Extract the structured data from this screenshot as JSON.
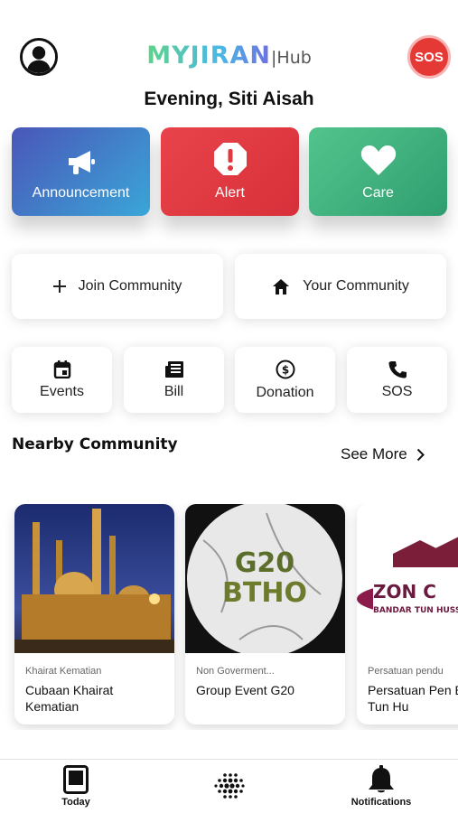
{
  "header": {
    "logo_brand": "MYJIRAN",
    "logo_sub": "|Hub",
    "sos_label": "SOS"
  },
  "greeting": "Evening, Siti Aisah",
  "big_tiles": [
    {
      "label": "Announcement",
      "icon": "megaphone-icon",
      "color": "#3f7fd0"
    },
    {
      "label": "Alert",
      "icon": "alert-octagon-icon",
      "color": "#e0393f"
    },
    {
      "label": "Care",
      "icon": "heart-icon",
      "color": "#3fb07f"
    }
  ],
  "mid_buttons": [
    {
      "label": "Join Community",
      "icon": "plus-icon"
    },
    {
      "label": "Your Community",
      "icon": "home-icon"
    }
  ],
  "small_buttons": [
    {
      "label": "Events",
      "icon": "calendar-icon"
    },
    {
      "label": "Bill",
      "icon": "receipt-icon"
    },
    {
      "label": "Donation",
      "icon": "dollar-coin-icon"
    },
    {
      "label": "SOS",
      "icon": "phone-icon"
    }
  ],
  "nearby": {
    "title": "Nearby Community",
    "see_more": "See More",
    "cards": [
      {
        "category": "Khairat Kematian",
        "name": "Cubaan Khairat Kematian"
      },
      {
        "category": "Non Goverment...",
        "name": "Group Event G20",
        "image_text": "G20 BTHO"
      },
      {
        "category": "Persatuan pendu",
        "name": "Persatuan Pen Bandar Tun Hu",
        "image_text_1": "ZON C",
        "image_text_2": "BANDAR TUN HUSS"
      }
    ]
  },
  "tabbar": {
    "today": "Today",
    "notifications": "Notifications"
  }
}
